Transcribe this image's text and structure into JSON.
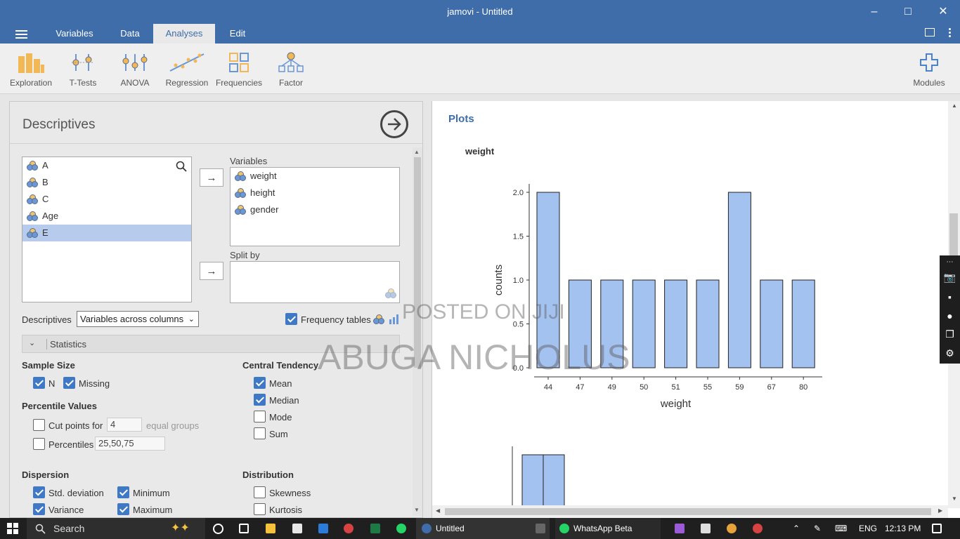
{
  "window": {
    "title": "jamovi - Untitled"
  },
  "menubar": {
    "tabs": [
      "Variables",
      "Data",
      "Analyses",
      "Edit"
    ],
    "active_tab": "Analyses"
  },
  "ribbon": {
    "buttons": [
      "Exploration",
      "T-Tests",
      "ANOVA",
      "Regression",
      "Frequencies",
      "Factor"
    ],
    "modules": "Modules"
  },
  "descriptives": {
    "title": "Descriptives",
    "source_vars": [
      "A",
      "B",
      "C",
      "Age",
      "E"
    ],
    "selected_var": "E",
    "variables_label": "Variables",
    "variables": [
      "weight",
      "height",
      "gender"
    ],
    "splitby_label": "Split by",
    "layout_label": "Descriptives",
    "layout_value": "Variables across columns",
    "freq_tables_label": "Frequency tables",
    "freq_tables_checked": true,
    "statistics_header": "Statistics",
    "sample_size": {
      "title": "Sample Size",
      "n": "N",
      "missing": "Missing"
    },
    "percentile": {
      "title": "Percentile Values",
      "cut_points": "Cut points for",
      "cut_value": "4",
      "equal_groups": "equal groups",
      "percentiles": "Percentiles",
      "percentiles_value": "25,50,75"
    },
    "central": {
      "title": "Central Tendency",
      "mean": "Mean",
      "median": "Median",
      "mode": "Mode",
      "sum": "Sum"
    },
    "dispersion": {
      "title": "Dispersion",
      "std": "Std. deviation",
      "variance": "Variance",
      "minimum": "Minimum",
      "maximum": "Maximum"
    },
    "distribution": {
      "title": "Distribution",
      "skewness": "Skewness",
      "kurtosis": "Kurtosis"
    }
  },
  "results": {
    "section_title": "Plots",
    "plot_title": "weight"
  },
  "chart_data": {
    "type": "bar",
    "title": "weight",
    "xlabel": "weight",
    "ylabel": "counts",
    "categories": [
      "44",
      "47",
      "49",
      "50",
      "51",
      "55",
      "59",
      "67",
      "80"
    ],
    "values": [
      2,
      1,
      1,
      1,
      1,
      1,
      2,
      1,
      1
    ],
    "ylim": [
      0,
      2
    ],
    "yticks": [
      "0.0",
      "0.5",
      "1.0",
      "1.5",
      "2.0"
    ],
    "bar_color": "#a4c2f0"
  },
  "watermark": {
    "line1": "POSTED ON JIJI",
    "line2": "ABUGA NICHOLUS"
  },
  "taskbar": {
    "search": "Search",
    "apps": [
      "Untitled",
      "WhatsApp Beta"
    ],
    "lang": "ENG",
    "time": "12:13 PM"
  },
  "colors": {
    "titlebar": "#3e6da9",
    "accent": "#3f78c5",
    "bar": "#a4c2f0"
  }
}
